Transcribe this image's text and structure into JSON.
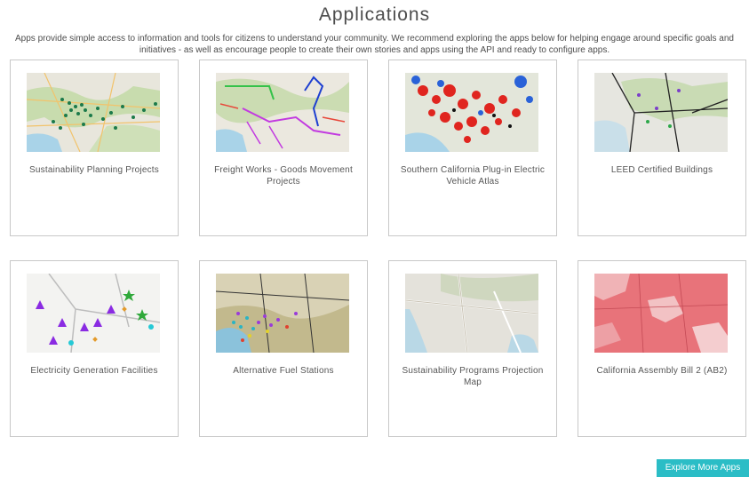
{
  "header": {
    "title": "Applications",
    "intro": "Apps provide simple access to information and tools for citizens to understand your community. We recommend exploring the apps below for helping engage around specific goals and initiatives - as well as encourage people to create their own stories and apps using the API and ready to configure apps."
  },
  "apps": [
    {
      "label": "Sustainability Planning Projects"
    },
    {
      "label": "Freight Works - Goods Movement Projects"
    },
    {
      "label": "Southern California Plug-in Electric Vehicle Atlas"
    },
    {
      "label": "LEED Certified Buildings"
    },
    {
      "label": "Electricity Generation Facilities"
    },
    {
      "label": "Alternative Fuel Stations"
    },
    {
      "label": "Sustainability Programs Projection Map"
    },
    {
      "label": "California Assembly Bill 2 (AB2)"
    }
  ],
  "explore_button": {
    "label": "Explore More Apps"
  },
  "colors": {
    "accent": "#2bbdc6",
    "card_border": "#c8c8c8",
    "text": "#4d4d4d"
  }
}
